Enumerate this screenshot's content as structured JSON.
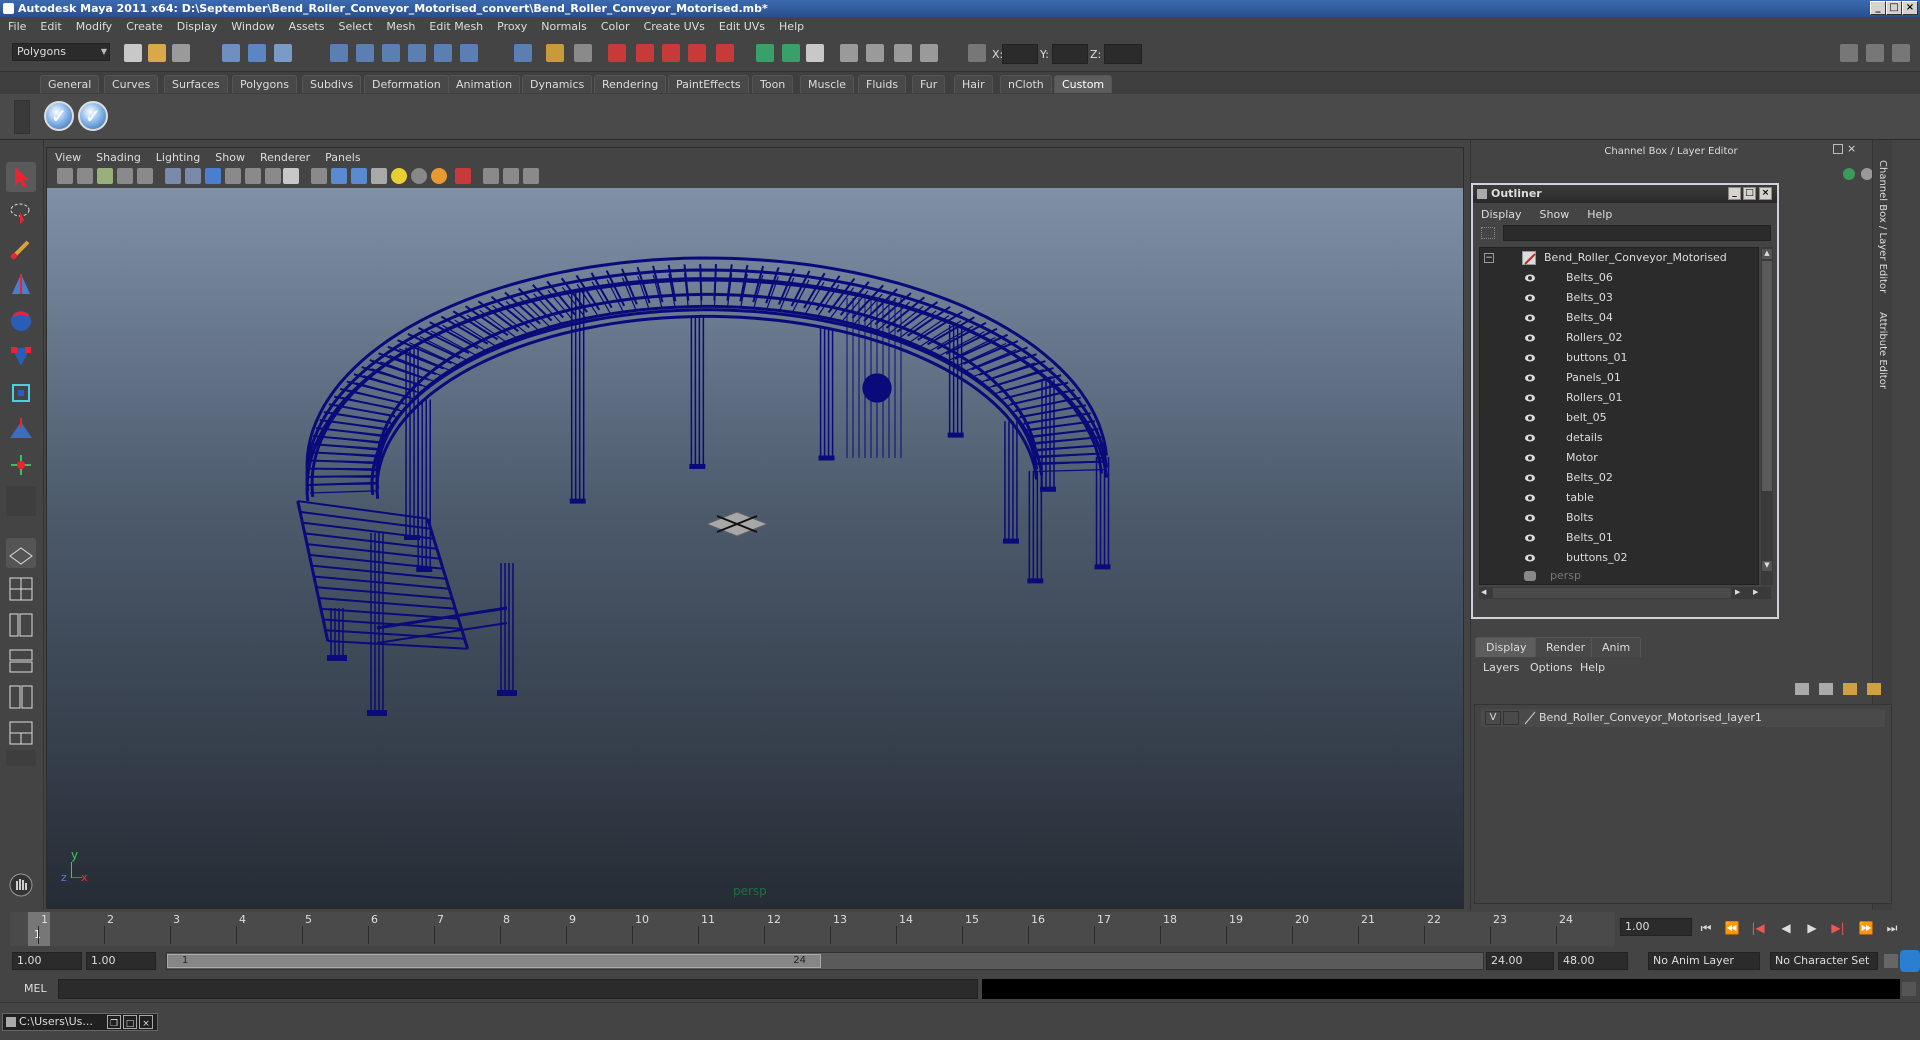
{
  "window": {
    "title": "Autodesk Maya 2011 x64: D:\\September\\Bend_Roller_Conveyor_Motorised_convert\\Bend_Roller_Conveyor_Motorised.mb*"
  },
  "menubar": [
    "File",
    "Edit",
    "Modify",
    "Create",
    "Display",
    "Window",
    "Assets",
    "Select",
    "Mesh",
    "Edit Mesh",
    "Proxy",
    "Normals",
    "Color",
    "Create UVs",
    "Edit UVs",
    "Help"
  ],
  "statusline": {
    "mode_selector": "Polygons",
    "x_label": "X:",
    "y_label": "Y:",
    "z_label": "Z:"
  },
  "shelf": {
    "tabs": [
      "General",
      "Curves",
      "Surfaces",
      "Polygons",
      "Subdivs",
      "Deformation",
      "Animation",
      "Dynamics",
      "Rendering",
      "PaintEffects",
      "Toon",
      "Muscle",
      "Fluids",
      "Fur",
      "Hair",
      "nCloth",
      "Custom"
    ],
    "active_tab": "Custom",
    "buttons": [
      "checkmark-icon",
      "checkmark-icon"
    ]
  },
  "viewport": {
    "menu": [
      "View",
      "Shading",
      "Lighting",
      "Show",
      "Renderer",
      "Panels"
    ],
    "camera_label": "persp",
    "axis_y": "y",
    "axis_x": "x",
    "axis_z": "z",
    "wire_color": "#0a0a7a"
  },
  "channel_box": {
    "title": "Channel Box / Layer Editor",
    "side_tab_1": "Channel Box / Layer Editor",
    "side_tab_2": "Attribute Editor"
  },
  "outliner": {
    "title": "Outliner",
    "menu": [
      "Display",
      "Show",
      "Help"
    ],
    "root": "Bend_Roller_Conveyor_Motorised",
    "items": [
      "Belts_06",
      "Belts_03",
      "Belts_04",
      "Rollers_02",
      "buttons_01",
      "Panels_01",
      "Rollers_01",
      "belt_05",
      "details",
      "Motor",
      "Belts_02",
      "table",
      "Bolts",
      "Belts_01",
      "buttons_02"
    ],
    "camera": "persp"
  },
  "layer_editor": {
    "tabs": [
      "Display",
      "Render",
      "Anim"
    ],
    "active_tab": "Display",
    "menu": [
      "Layers",
      "Options",
      "Help"
    ],
    "layer_visibility": "V",
    "layer_name": "Bend_Roller_Conveyor_Motorised_layer1"
  },
  "timeline": {
    "ticks": [
      "1",
      "2",
      "3",
      "4",
      "5",
      "6",
      "7",
      "8",
      "9",
      "10",
      "11",
      "12",
      "13",
      "14",
      "15",
      "16",
      "17",
      "18",
      "19",
      "20",
      "21",
      "22",
      "23",
      "24"
    ],
    "current_frame_marker": "1",
    "current_frame": "1.00"
  },
  "range": {
    "start_time": "1.00",
    "playback_start": "1.00",
    "slider_start": "1",
    "slider_end": "24",
    "playback_end": "24.00",
    "end_time": "48.00",
    "anim_layer": "No Anim Layer",
    "character_set": "No Character Set"
  },
  "commandline": {
    "label": "MEL"
  },
  "taskbar": {
    "item": "C:\\Users\\Us..."
  }
}
